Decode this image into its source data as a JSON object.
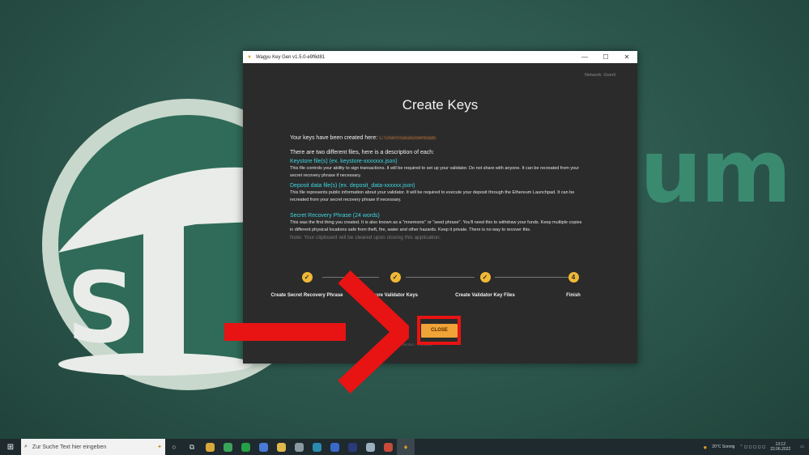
{
  "wallpaper": {
    "text": "um"
  },
  "window": {
    "title": "Wagyu Key Gen v1.5.0-e9f6d81",
    "controls": {
      "minimize": "—",
      "maximize": "☐",
      "close": "✕"
    },
    "network": "Network: Goerli",
    "heading": "Create Keys",
    "created_label": "Your keys have been created here:",
    "created_path": "C:\\Users\\Sasa\\Downloads",
    "description_title": "There are two different files, here is a description of each:",
    "sections": [
      {
        "title": "Keystore file(s) (ex. keystore-xxxxxxx.json)",
        "body": "This file controls your ability to sign transactions. It will be required to set up your validator. Do not share with anyone. It can be recreated from your secret recovery phrase if necessary."
      },
      {
        "title": "Deposit data file(s) (ex. deposit_data-xxxxxx.json)",
        "body": "This file represents public information about your validator. It will be required to execute your deposit through the Ethereum Launchpad. It can be recreated from your secret recovery phrase if necessary."
      }
    ],
    "srp": {
      "title": "Secret Recovery Phrase (24 words)",
      "body": "This was the first thing you created. It is also known as a \"mnemonic\" or \"seed phrase\". You'll need this to withdraw your funds. Keep multiple copies in different physical locations safe from theft, fire, water and other hazards. Keep it private. There is no way to recover this.",
      "note": "Note: Your clipboard will be cleared upon closing this application."
    },
    "steps": [
      {
        "label": "Create Secret Recovery Phrase",
        "mark": "✓"
      },
      {
        "label": "nure Validator Keys",
        "mark": "✓"
      },
      {
        "label": "Create Validator Key Files",
        "mark": "✓"
      },
      {
        "label": "Finish",
        "mark": "4"
      }
    ],
    "close_label": "CLOSE",
    "version": "Version ... e9f6d81"
  },
  "taskbar": {
    "start_icon": "windows-icon",
    "search_placeholder": "Zur Suche Text hier eingeben",
    "tray_weather": "20°C Sonnig",
    "tray_time": "13:12",
    "tray_date": "22.06.2022"
  },
  "colors": {
    "accent": "#f0a336",
    "link": "#3fd6e0",
    "window_bg": "#2b2b2b",
    "highlight": "#e81313"
  }
}
